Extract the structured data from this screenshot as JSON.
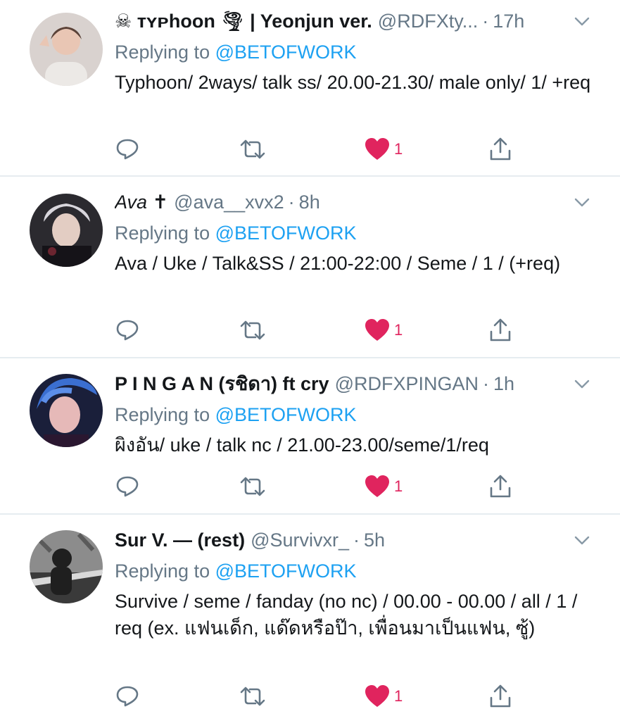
{
  "colors": {
    "accent": "#1da1f2",
    "muted": "#657786",
    "like": "#e0245e",
    "divider": "#e6ecf0"
  },
  "tweets": [
    {
      "name": "☠ ᴛʏᴘhoon 🌪 | Yeonjun ver.",
      "handle": "@RDFXty...",
      "separator": "·",
      "time": "17h",
      "reply_prefix": "Replying to ",
      "reply_to": "@BETOFWORK",
      "text": "Typhoon/ 2ways/ talk ss/ 20.00-21.30/ male only/ 1/ +req",
      "likes": "1",
      "avatar_icon": "user-avatar-photo"
    },
    {
      "name": "Ava ✝",
      "handle": "@ava__xvx2",
      "separator": "·",
      "time": "8h",
      "reply_prefix": "Replying to ",
      "reply_to": "@BETOFWORK",
      "text": "Ava / Uke / Talk&SS / 21:00-22:00 / Seme / 1 / (+req)",
      "likes": "1",
      "avatar_icon": "user-avatar-photo"
    },
    {
      "name": "P I N G A N (รชิดา) ft cry",
      "handle": "@RDFXPINGAN",
      "separator": "·",
      "time": "1h",
      "reply_prefix": "Replying to ",
      "reply_to": "@BETOFWORK",
      "text": "ผิงอัน/ uke / talk nc / 21.00-23.00/seme/1/req",
      "likes": "1",
      "avatar_icon": "user-avatar-photo"
    },
    {
      "name": "Sur V. — (rest)",
      "handle": "@Survivxr_",
      "separator": "·",
      "time": "5h",
      "reply_prefix": "Replying to ",
      "reply_to": "@BETOFWORK",
      "text": "Survive / seme / fanday (no nc) / 00.00 - 00.00 / all / 1 / req (ex. แฟนเด็ก, แด๊ดหรือป๊า, เพื่อนมาเป็นแฟน, ซู้)",
      "likes": "1",
      "avatar_icon": "user-avatar-photo"
    }
  ]
}
